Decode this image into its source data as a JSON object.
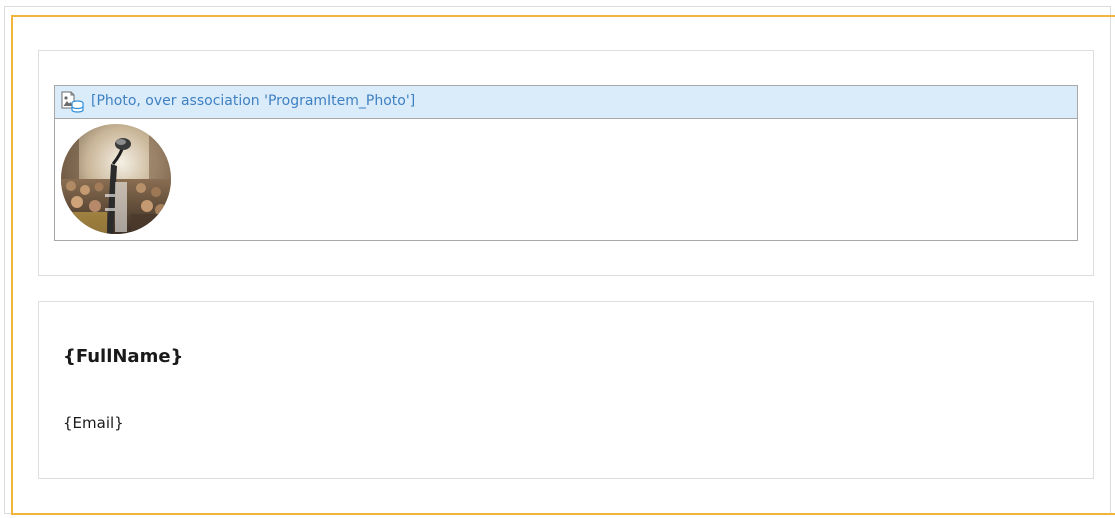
{
  "photo_widget": {
    "caption": "[Photo, over association 'ProgramItem_Photo']",
    "icon": "image-datasource-icon",
    "image": "speaker-microphone-photo"
  },
  "person": {
    "full_name": "{FullName}",
    "email": "{Email}"
  },
  "colors": {
    "selection_frame": "#f0b53a",
    "caption_text": "#3f80c3",
    "header_background": "#daecf9",
    "panel_border": "#dedede"
  }
}
